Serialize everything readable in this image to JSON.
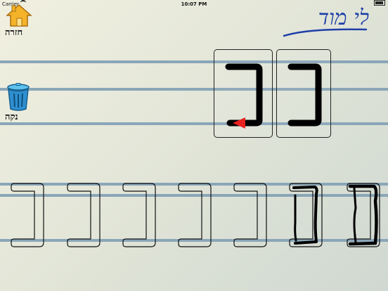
{
  "status_bar": {
    "carrier": "Carrier",
    "time": "10:07 PM"
  },
  "title": "לי מוד",
  "buttons": {
    "home_label": "חזרה",
    "clear_label": "נקה"
  },
  "practice": {
    "letter": "כ",
    "completed_slots": 2,
    "total_slots": 7
  },
  "colors": {
    "title": "#1f3fa8",
    "arrow": "#e8201f",
    "ruled_line": "#8aa6b8"
  }
}
